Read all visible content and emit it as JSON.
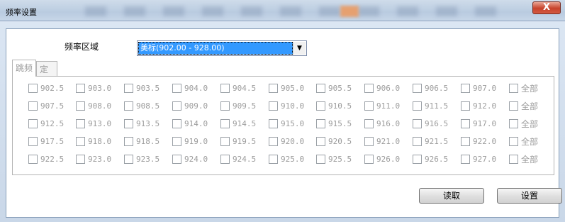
{
  "window": {
    "title": "频率设置",
    "close_label": "X"
  },
  "region": {
    "label": "频率区域",
    "selected": "美标(902.00 - 928.00)"
  },
  "tabs": [
    {
      "label": "跳频"
    },
    {
      "label": "定频"
    }
  ],
  "frequency_rows": [
    [
      "902.5",
      "903.0",
      "903.5",
      "904.0",
      "904.5",
      "905.0",
      "905.5",
      "906.0",
      "906.5",
      "907.0"
    ],
    [
      "907.5",
      "908.0",
      "908.5",
      "909.0",
      "909.5",
      "910.0",
      "910.5",
      "911.0",
      "911.5",
      "912.0"
    ],
    [
      "912.5",
      "913.0",
      "913.5",
      "914.0",
      "914.5",
      "915.0",
      "915.5",
      "916.0",
      "916.5",
      "917.0"
    ],
    [
      "917.5",
      "918.0",
      "918.5",
      "919.0",
      "919.5",
      "920.0",
      "920.5",
      "921.0",
      "921.5",
      "922.0"
    ],
    [
      "922.5",
      "923.0",
      "923.5",
      "924.0",
      "924.5",
      "925.0",
      "925.5",
      "926.0",
      "926.5",
      "927.0"
    ]
  ],
  "select_all_label": "全部",
  "buttons": {
    "read": "读取",
    "set": "设置"
  }
}
